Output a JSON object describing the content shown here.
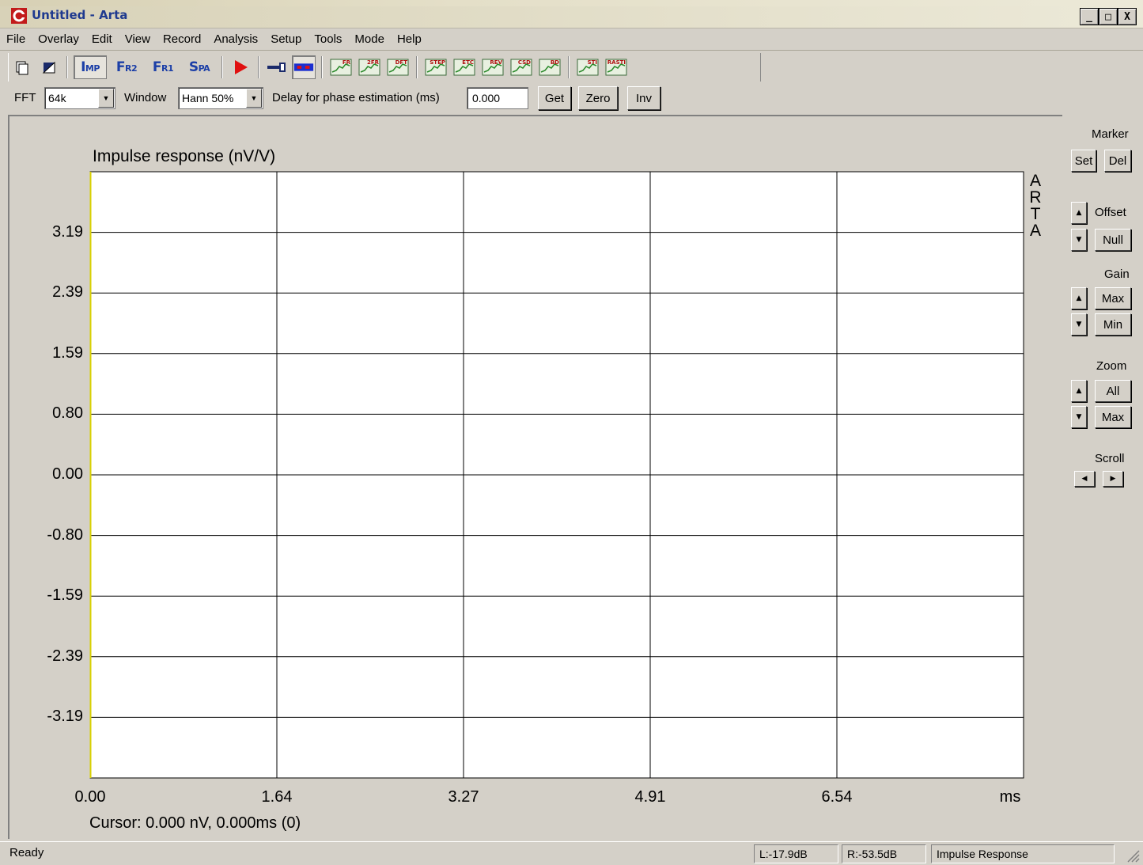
{
  "window": {
    "title": "Untitled - Arta",
    "minimize_glyph": "_",
    "maximize_glyph": "□",
    "close_glyph": "X"
  },
  "menu": [
    "File",
    "Overlay",
    "Edit",
    "View",
    "Record",
    "Analysis",
    "Setup",
    "Tools",
    "Mode",
    "Help"
  ],
  "toolbar": {
    "imp": "IMP",
    "fr2": "FR2",
    "fr1": "FR1",
    "spa": "SPA",
    "chart_tags": [
      "FR",
      "2FR",
      "DFT",
      "STEP",
      "ETC",
      "REV",
      "CSD",
      "BD",
      "STI",
      "RASTI"
    ]
  },
  "options": {
    "fft_label": "FFT",
    "fft_value": "64k",
    "window_label": "Window",
    "window_value": "Hann 50%",
    "delay_label": "Delay for phase estimation (ms)",
    "delay_value": "0.000",
    "get_button": "Get",
    "zero_button": "Zero",
    "inv_button": "Inv"
  },
  "plot": {
    "title": "Impulse response (nV/V)",
    "watermark": "A\nR\nT\nA",
    "y_ticks": [
      "3.19",
      "2.39",
      "1.59",
      "0.80",
      "0.00",
      "-0.80",
      "-1.59",
      "-2.39",
      "-3.19"
    ],
    "x_ticks": [
      "0.00",
      "1.64",
      "3.27",
      "4.91",
      "6.54"
    ],
    "x_unit": "ms",
    "cursor_text": "Cursor: 0.000 nV, 0.000ms (0)"
  },
  "right_panel": {
    "marker_label": "Marker",
    "set_button": "Set",
    "del_button": "Del",
    "offset_label": "Offset",
    "null_button": "Null",
    "gain_label": "Gain",
    "gain_max_button": "Max",
    "gain_min_button": "Min",
    "zoom_label": "Zoom",
    "zoom_all_button": "All",
    "zoom_max_button": "Max",
    "scroll_label": "Scroll"
  },
  "status": {
    "ready": "Ready",
    "left_level": "L:-17.9dB",
    "right_level": "R:-53.5dB",
    "mode": "Impulse Response"
  },
  "colors": {
    "background": "#d4d0c8",
    "plot_bg": "#ffffff",
    "grid": "#000000",
    "left_axis": "#d8d000",
    "toolbar_text": "#1c3fa7",
    "play": "#e01010"
  }
}
